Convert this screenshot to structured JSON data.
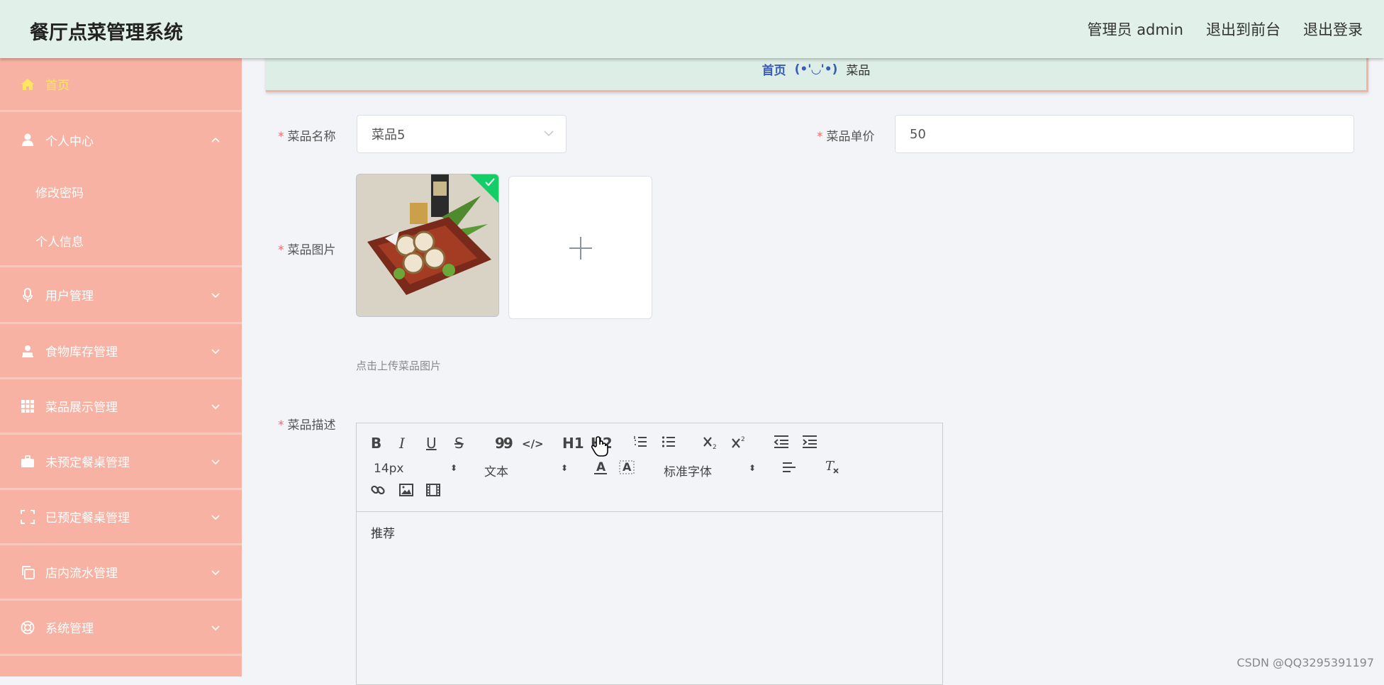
{
  "header": {
    "title": "餐厅点菜管理系统",
    "admin_label": "管理员 admin",
    "front_link": "退出到前台",
    "logout_link": "退出登录"
  },
  "sidebar": {
    "home": "首页",
    "personal": {
      "label": "个人中心",
      "children": [
        "修改密码",
        "个人信息"
      ]
    },
    "items": [
      {
        "label": "用户管理",
        "icon": "microphone-icon"
      },
      {
        "label": "食物库存管理",
        "icon": "person-stamp-icon"
      },
      {
        "label": "菜品展示管理",
        "icon": "grid-icon"
      },
      {
        "label": "未预定餐桌管理",
        "icon": "briefcase-icon"
      },
      {
        "label": "已预定餐桌管理",
        "icon": "fullscreen-icon"
      },
      {
        "label": "店内流水管理",
        "icon": "copy-icon"
      },
      {
        "label": "系统管理",
        "icon": "lifebuoy-icon"
      }
    ],
    "active_color": "#ffe65c",
    "background": "#f7b2a3"
  },
  "breadcrumb": {
    "home": "首页",
    "separator": "(•'◡'•)",
    "current": "菜品"
  },
  "form": {
    "name_label": "菜品名称",
    "name_value": "菜品5",
    "price_label": "菜品单价",
    "price_value": "50",
    "image_label": "菜品图片",
    "upload_hint": "点击上传菜品图片",
    "desc_label": "菜品描述",
    "required_mark": "*"
  },
  "editor": {
    "toolbar": {
      "bold": "B",
      "italic": "I",
      "underline": "U",
      "strike": "S",
      "quote": "99",
      "code": "</>",
      "h1": "H1",
      "h2": "H2",
      "font_size": "14px",
      "header_select": "文本",
      "font_family": "标准字体"
    },
    "content": "推荐"
  },
  "watermark": "CSDN @QQ3295391197"
}
